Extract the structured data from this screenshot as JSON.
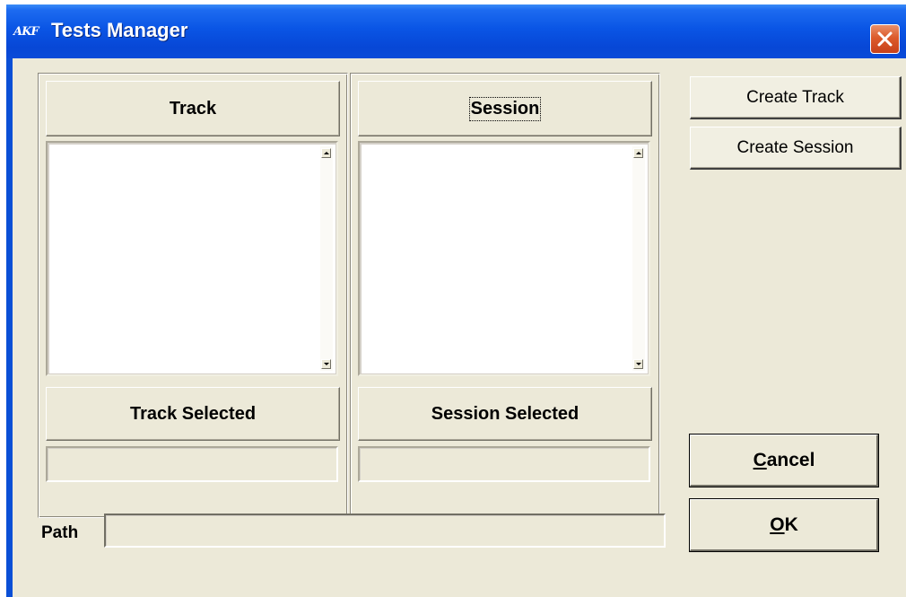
{
  "window": {
    "title": "Tests Manager",
    "app_icon_text": "AKF",
    "accent_color": "#0a55e5",
    "close_button_color": "#dc5b2c"
  },
  "track_panel": {
    "header_label": "Track",
    "list_items": [],
    "selected_header_label": "Track Selected",
    "selected_value": ""
  },
  "session_panel": {
    "header_label": "Session",
    "list_items": [],
    "selected_header_label": "Session Selected",
    "selected_value": ""
  },
  "path": {
    "label": "Path",
    "value": ""
  },
  "buttons": {
    "create_track": "Create Track",
    "create_session": "Create Session",
    "cancel_underlined": "C",
    "cancel_rest": "ancel",
    "ok_underlined": "O",
    "ok_rest": "K"
  },
  "icons": {
    "app": "akf-logo-icon",
    "close": "close-icon",
    "scroll_up": "scroll-up-arrow-icon",
    "scroll_down": "scroll-down-arrow-icon"
  }
}
